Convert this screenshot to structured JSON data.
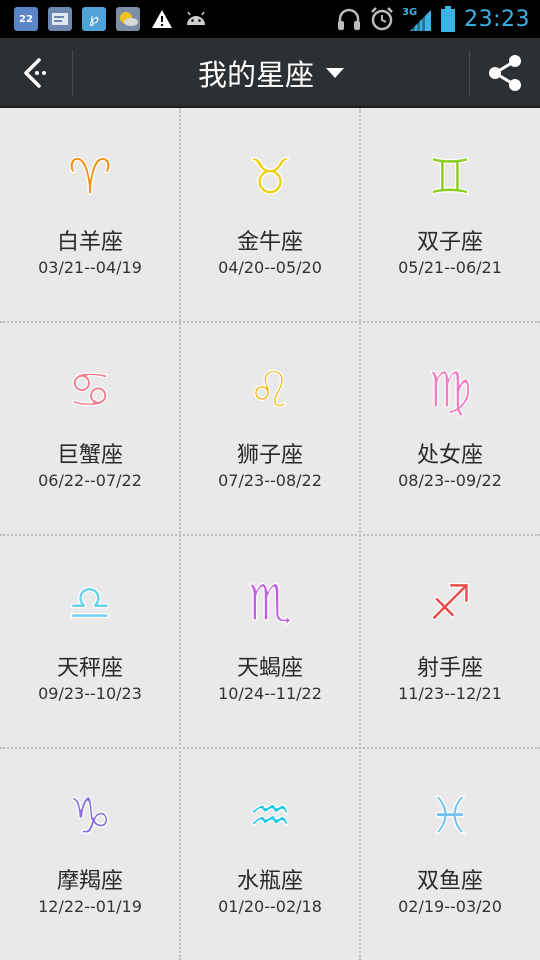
{
  "status_bar": {
    "time": "23:23",
    "network": "3G",
    "left_icons": [
      "calendar-icon",
      "message-icon",
      "app-icon",
      "weather-icon",
      "warning-icon",
      "android-icon"
    ],
    "right_icons": [
      "headphones-icon",
      "alarm-icon",
      "signal-icon",
      "battery-icon"
    ]
  },
  "header": {
    "title": "我的星座",
    "back_icon": "back-arrow-icon",
    "dropdown_icon": "dropdown-triangle-icon",
    "share_icon": "share-icon",
    "background": "#2d3033"
  },
  "signs": [
    {
      "name": "白羊座",
      "dates": "03/21--04/19",
      "symbol": "♈",
      "color": "#f29418"
    },
    {
      "name": "金牛座",
      "dates": "04/20--05/20",
      "symbol": "♉",
      "color": "#ecd21b"
    },
    {
      "name": "双子座",
      "dates": "05/21--06/21",
      "symbol": "♊",
      "color": "#8bcc21"
    },
    {
      "name": "巨蟹座",
      "dates": "06/22--07/22",
      "symbol": "♋",
      "color": "#f07a8e"
    },
    {
      "name": "狮子座",
      "dates": "07/23--08/22",
      "symbol": "♌",
      "color": "#f2ba1a"
    },
    {
      "name": "处女座",
      "dates": "08/23--09/22",
      "symbol": "♍",
      "color": "#ef7fc0"
    },
    {
      "name": "天秤座",
      "dates": "09/23--10/23",
      "symbol": "♎",
      "color": "#6cd0ec"
    },
    {
      "name": "天蝎座",
      "dates": "10/24--11/22",
      "symbol": "♏",
      "color": "#c25ee0"
    },
    {
      "name": "射手座",
      "dates": "11/23--12/21",
      "symbol": "♐",
      "color": "#ea4a4a"
    },
    {
      "name": "摩羯座",
      "dates": "12/22--01/19",
      "symbol": "♑",
      "color": "#8a6fe2"
    },
    {
      "name": "水瓶座",
      "dates": "01/20--02/18",
      "symbol": "♒",
      "color": "#22c6e6"
    },
    {
      "name": "双鱼座",
      "dates": "02/19--03/20",
      "symbol": "♓",
      "color": "#76c2ee"
    }
  ]
}
